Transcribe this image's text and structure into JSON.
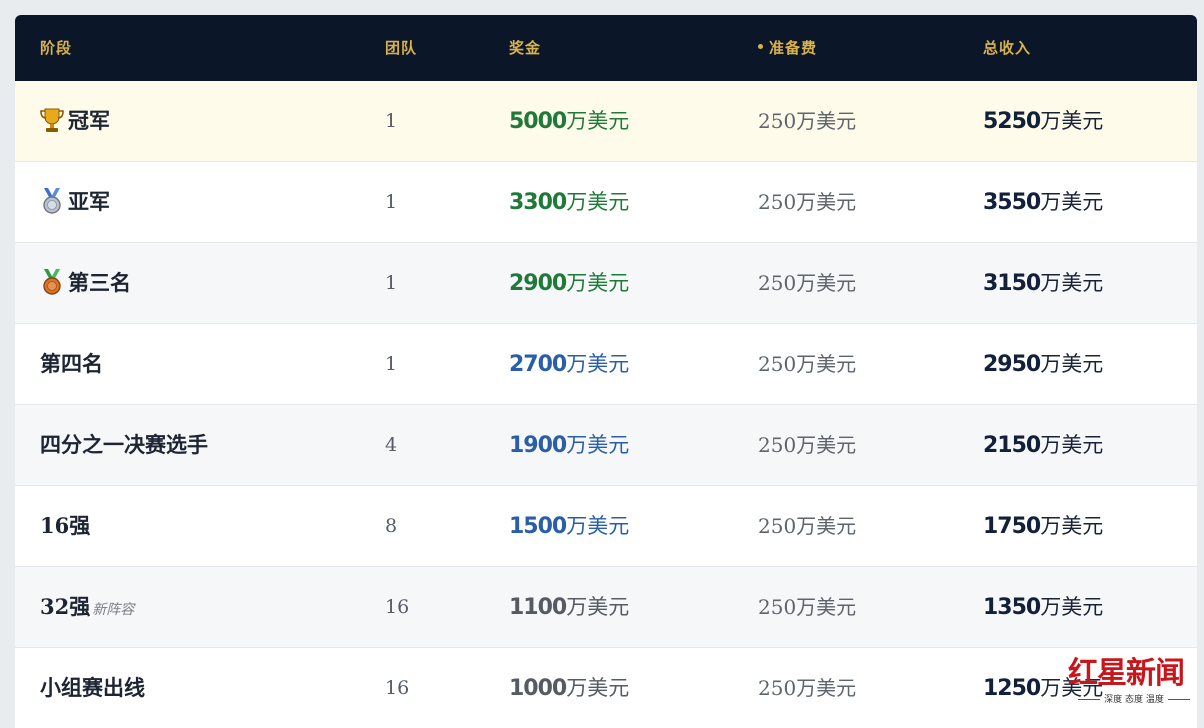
{
  "header": {
    "stage": "阶段",
    "teams": "团队",
    "prize": "奖金",
    "fee": "准备费",
    "total": "总收入"
  },
  "colors": {
    "header_bg": "#0c1629",
    "header_text": "#d8b24a",
    "prize_green": "#1f7a3a",
    "prize_blue": "#2a5ea8",
    "prize_gray": "#555a63",
    "total_navy": "#13203a"
  },
  "rows": [
    {
      "stage": "冠军",
      "icon": "trophy-icon",
      "teams": "1",
      "prize_num": "5000",
      "prize_unit": "万美元",
      "fee": "250万美元",
      "total_num": "5250",
      "total_unit": "万美元"
    },
    {
      "stage": "亚军",
      "icon": "silver-medal-icon",
      "teams": "1",
      "prize_num": "3300",
      "prize_unit": "万美元",
      "fee": "250万美元",
      "total_num": "3550",
      "total_unit": "万美元"
    },
    {
      "stage": "第三名",
      "icon": "bronze-medal-icon",
      "teams": "1",
      "prize_num": "2900",
      "prize_unit": "万美元",
      "fee": "250万美元",
      "total_num": "3150",
      "total_unit": "万美元"
    },
    {
      "stage": "第四名",
      "teams": "1",
      "prize_num": "2700",
      "prize_unit": "万美元",
      "fee": "250万美元",
      "total_num": "2950",
      "total_unit": "万美元"
    },
    {
      "stage": "四分之一决赛选手",
      "teams": "4",
      "prize_num": "1900",
      "prize_unit": "万美元",
      "fee": "250万美元",
      "total_num": "2150",
      "total_unit": "万美元"
    },
    {
      "stage": "16强",
      "teams": "8",
      "prize_num": "1500",
      "prize_unit": "万美元",
      "fee": "250万美元",
      "total_num": "1750",
      "total_unit": "万美元"
    },
    {
      "stage": "32强",
      "tag": "新阵容",
      "teams": "16",
      "prize_num": "1100",
      "prize_unit": "万美元",
      "fee": "250万美元",
      "total_num": "1350",
      "total_unit": "万美元"
    },
    {
      "stage": "小组赛出线",
      "teams": "16",
      "prize_num": "1000",
      "prize_unit": "万美元",
      "fee": "250万美元",
      "total_num": "1250",
      "total_unit": "万美元"
    }
  ],
  "watermark": {
    "main": "红星新闻",
    "sub": "深度 态度 温度"
  }
}
